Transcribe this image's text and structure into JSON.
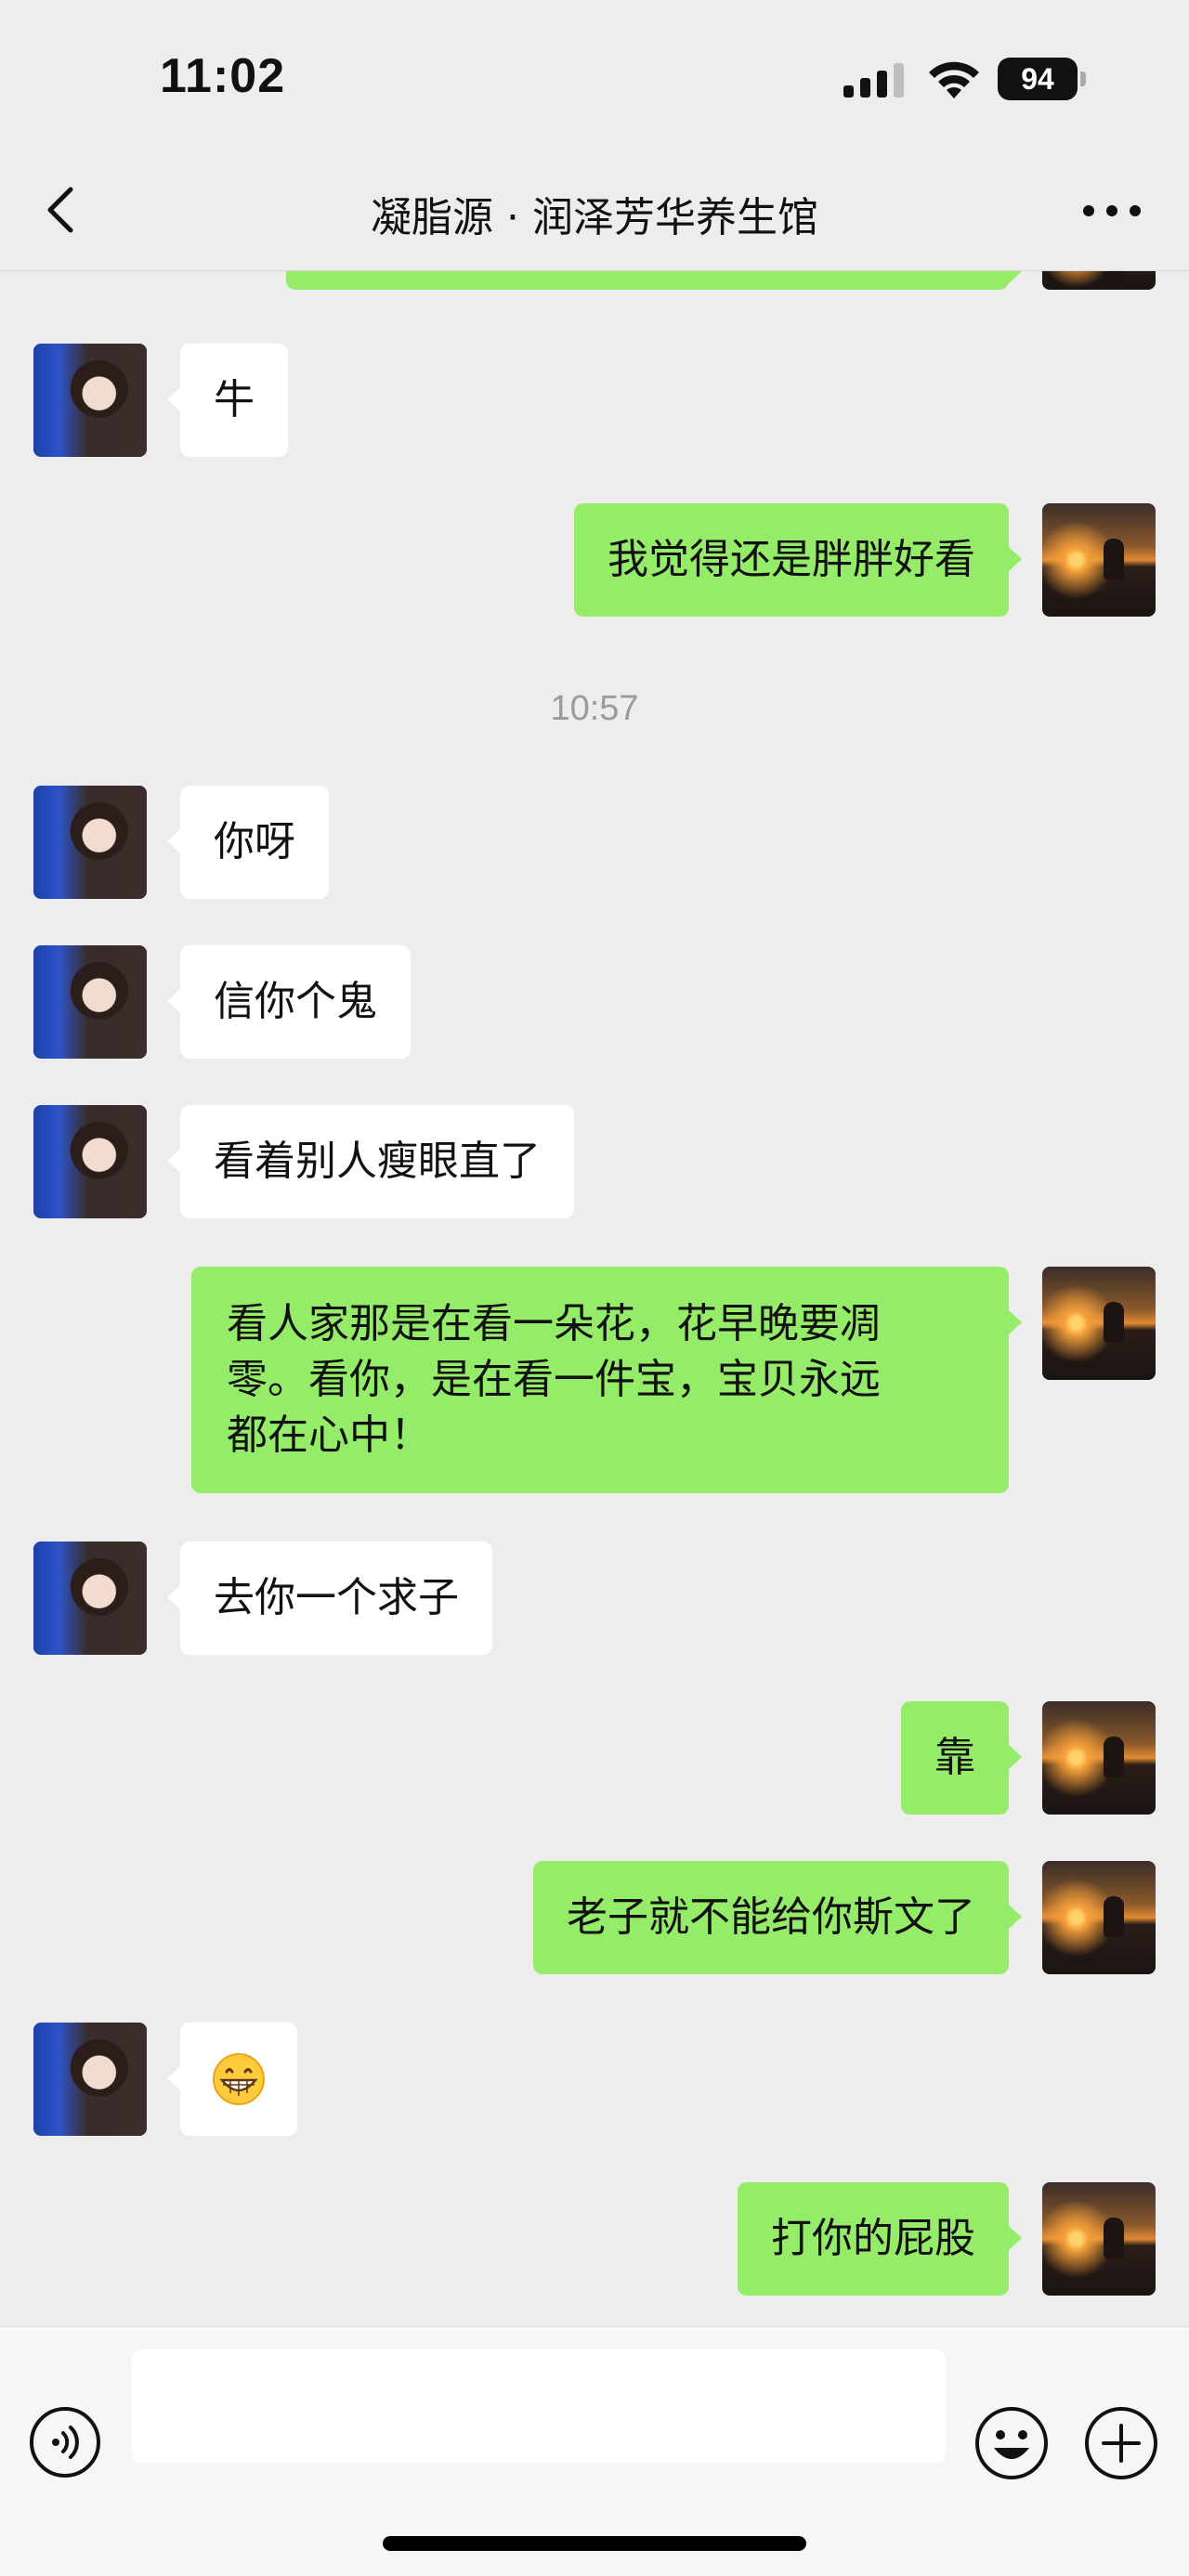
{
  "status_bar": {
    "time": "11:02",
    "battery": "94"
  },
  "nav": {
    "title": "凝脂源 · 润泽芳华养生馆"
  },
  "messages": [
    {
      "side": "right",
      "text": "",
      "partial": true
    },
    {
      "side": "left",
      "text": "牛"
    },
    {
      "side": "right",
      "text": "我觉得还是胖胖好看"
    },
    {
      "type": "time",
      "text": "10:57"
    },
    {
      "side": "left",
      "text": "你呀"
    },
    {
      "side": "left",
      "text": "信你个鬼"
    },
    {
      "side": "left",
      "text": "看着别人瘦眼直了"
    },
    {
      "side": "right",
      "lines": [
        "看人家那是在看一朵花，花早晚要凋",
        "零。看你，是在看一件宝，宝贝永远",
        "都在心中！"
      ]
    },
    {
      "side": "left",
      "text": "去你一个求子"
    },
    {
      "side": "right",
      "text": "靠"
    },
    {
      "side": "right",
      "text": "老子就不能给你斯文了"
    },
    {
      "side": "left",
      "emoji": "grinning-face-emoji"
    },
    {
      "side": "right",
      "text": "打你的屁股"
    }
  ],
  "input": {
    "value": "",
    "placeholder": ""
  },
  "colors": {
    "background": "#ededed",
    "outgoing_bubble": "#95ec69",
    "incoming_bubble": "#ffffff"
  }
}
